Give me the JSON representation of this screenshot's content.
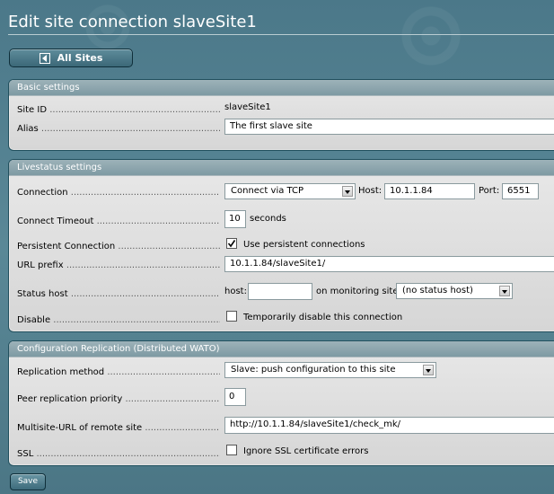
{
  "page_title": "Edit site connection slaveSite1",
  "back_button": {
    "label": "All Sites",
    "icon": "back-arrow-icon"
  },
  "basic": {
    "header": "Basic settings",
    "site_id_label": "Site ID",
    "site_id_value": "slaveSite1",
    "alias_label": "Alias",
    "alias_value": "The first slave site"
  },
  "livestatus": {
    "header": "Livestatus settings",
    "connection_label": "Connection",
    "connection_value": "Connect via TCP",
    "host_label": "Host:",
    "host_value": "10.1.1.84",
    "port_label": "Port:",
    "port_value": "6551",
    "timeout_label": "Connect Timeout",
    "timeout_value": "10",
    "timeout_unit": "seconds",
    "persistent_label": "Persistent Connection",
    "persistent_checked": true,
    "persistent_text": "Use persistent connections",
    "url_prefix_label": "URL prefix",
    "url_prefix_value": "10.1.1.84/slaveSite1/",
    "status_host_label": "Status host",
    "status_host_host_label": "host:",
    "status_host_value": "",
    "monitoring_site_label": "on monitoring site:",
    "monitoring_site_value": "(no status host)",
    "disable_label": "Disable",
    "disable_checked": false,
    "disable_text": "Temporarily disable this connection"
  },
  "replication": {
    "header": "Configuration Replication (Distributed WATO)",
    "method_label": "Replication method",
    "method_value": "Slave: push configuration to this site",
    "priority_label": "Peer replication priority",
    "priority_value": "0",
    "multisite_url_label": "Multisite-URL of remote site",
    "multisite_url_value": "http://10.1.1.84/slaveSite1/check_mk/",
    "ssl_label": "SSL",
    "ssl_checked": false,
    "ssl_text": "Ignore SSL certificate errors"
  },
  "save_button": {
    "label": "Save"
  },
  "colors": {
    "background": "#4f7d8c",
    "section_header": "#8ba5ad",
    "form_bg": "#e0e0e0"
  }
}
